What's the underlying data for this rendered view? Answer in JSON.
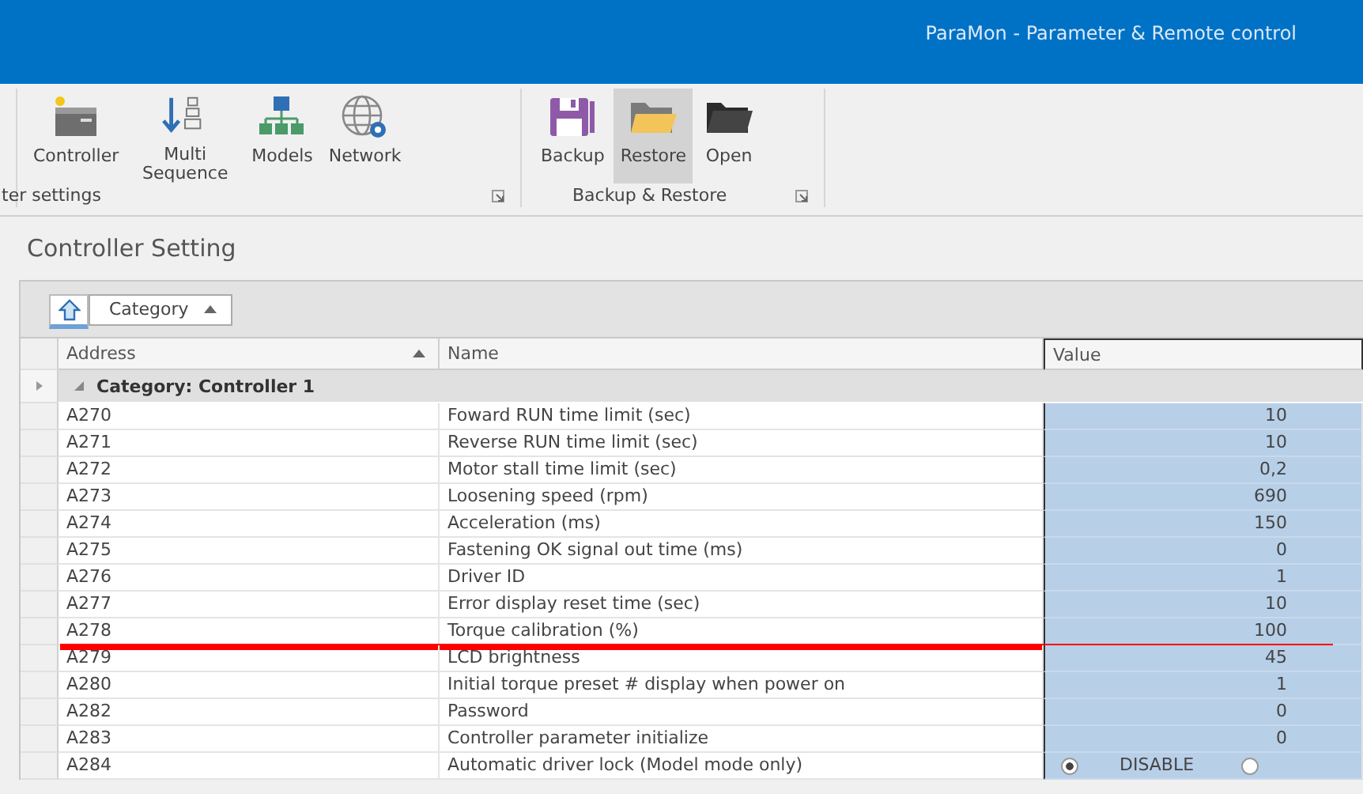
{
  "window": {
    "title": "ParaMon - Parameter & Remote control"
  },
  "ribbon": {
    "groups": [
      {
        "label": "ter settings",
        "items": [
          {
            "label": "Controller",
            "selected": false
          },
          {
            "label": "Multi Sequence",
            "selected": false
          },
          {
            "label": "Models",
            "selected": false
          },
          {
            "label": "Network",
            "selected": false
          }
        ]
      },
      {
        "label": "Backup & Restore",
        "items": [
          {
            "label": "Backup",
            "selected": false
          },
          {
            "label": "Restore",
            "selected": true
          },
          {
            "label": "Open",
            "selected": false
          }
        ]
      }
    ]
  },
  "panel": {
    "title": "Controller Setting"
  },
  "grid": {
    "group_panel": {
      "button": "Category",
      "sorted": true
    },
    "columns": [
      {
        "label": "Address",
        "sorted": true,
        "selected": false
      },
      {
        "label": "Name",
        "sorted": false,
        "selected": false
      },
      {
        "label": "Value",
        "sorted": false,
        "selected": true
      }
    ],
    "group_row": {
      "label": "Category: Controller 1",
      "expanded": true
    },
    "rows": [
      {
        "address": "A270",
        "name": "Foward RUN time limit (sec)",
        "kind": "number",
        "value": "10",
        "marked": false
      },
      {
        "address": "A271",
        "name": "Reverse RUN time limit (sec)",
        "kind": "number",
        "value": "10",
        "marked": false
      },
      {
        "address": "A272",
        "name": "Motor stall time limit (sec)",
        "kind": "number",
        "value": "0,2",
        "marked": false
      },
      {
        "address": "A273",
        "name": "Loosening speed (rpm)",
        "kind": "number",
        "value": "690",
        "marked": false
      },
      {
        "address": "A274",
        "name": "Acceleration (ms)",
        "kind": "number",
        "value": "150",
        "marked": false
      },
      {
        "address": "A275",
        "name": "Fastening OK signal out time (ms)",
        "kind": "number",
        "value": "0",
        "marked": false
      },
      {
        "address": "A276",
        "name": "Driver ID",
        "kind": "number",
        "value": "1",
        "marked": false
      },
      {
        "address": "A277",
        "name": "Error display reset time (sec)",
        "kind": "number",
        "value": "10",
        "marked": false
      },
      {
        "address": "A278",
        "name": "Torque calibration (%)",
        "kind": "number",
        "value": "100",
        "marked": true
      },
      {
        "address": "A279",
        "name": "LCD brightness",
        "kind": "number",
        "value": "45",
        "marked": false
      },
      {
        "address": "A280",
        "name": "Initial torque preset # display when power on",
        "kind": "number",
        "value": "1",
        "marked": false
      },
      {
        "address": "A282",
        "name": "Password",
        "kind": "number",
        "value": "0",
        "marked": false
      },
      {
        "address": "A283",
        "name": "Controller parameter initialize",
        "kind": "number",
        "value": "0",
        "marked": false
      },
      {
        "address": "A284",
        "name": "Automatic driver lock (Model mode only)",
        "kind": "radio",
        "options": [
          {
            "label": "DISABLE",
            "selected": true
          },
          {
            "selected": false
          }
        ],
        "marked": false
      }
    ]
  }
}
